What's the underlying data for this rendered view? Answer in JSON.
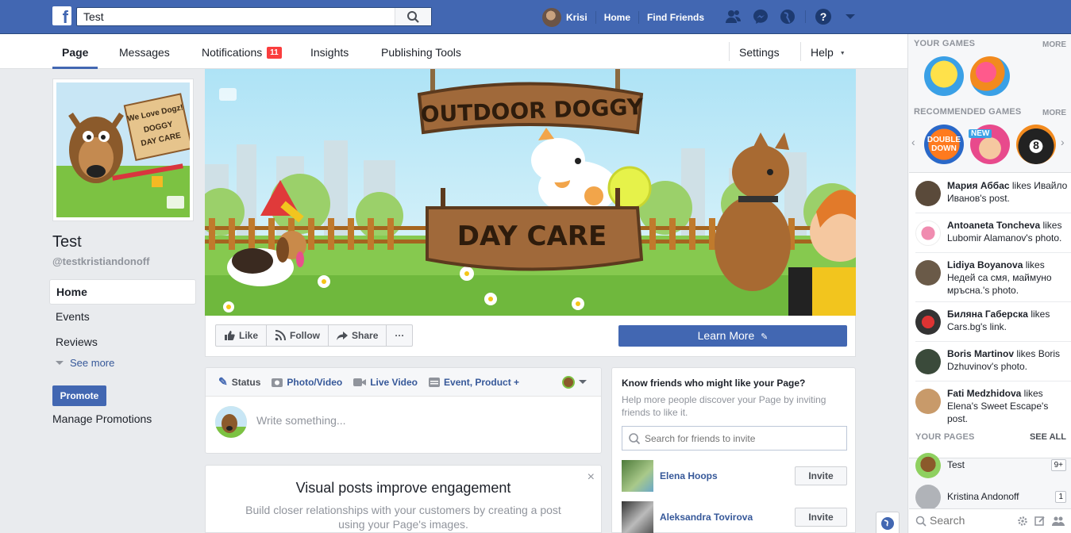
{
  "topbar": {
    "logo_letter": "f",
    "search_value": "Test",
    "user_name": "Krisi",
    "home": "Home",
    "find_friends": "Find Friends"
  },
  "pagenav": {
    "tabs": [
      {
        "label": "Page"
      },
      {
        "label": "Messages"
      },
      {
        "label": "Notifications",
        "badge": "11"
      },
      {
        "label": "Insights"
      },
      {
        "label": "Publishing Tools"
      }
    ],
    "settings": "Settings",
    "help": "Help",
    "help_caret": "▼"
  },
  "profile": {
    "name": "Test",
    "handle": "@testkristiandonoff",
    "pic_sign": [
      "We Love Dogz!",
      "DOGGY",
      "DAY CARE"
    ]
  },
  "leftnav": {
    "items": [
      "Home",
      "Events",
      "Reviews"
    ],
    "see_more": "See more",
    "promote": "Promote",
    "manage_promotions": "Manage Promotions"
  },
  "cover": {
    "sign_top": "OUTDOOR DOGGY",
    "sign_bottom": "DAY CARE"
  },
  "actions": {
    "like": "Like",
    "follow": "Follow",
    "share": "Share",
    "more": "···",
    "learn_more": "Learn More"
  },
  "composer": {
    "tabs": [
      "Status",
      "Photo/Video",
      "Live Video",
      "Event, Product +"
    ],
    "placeholder": "Write something..."
  },
  "visual_card": {
    "title": "Visual posts improve engagement",
    "desc": "Build closer relationships with your customers by creating a post using your Page's images.",
    "close": "×"
  },
  "invite": {
    "title": "Know friends who might like your Page?",
    "desc": "Help more people discover your Page by inviting friends to like it.",
    "search_placeholder": "Search for friends to invite",
    "friends": [
      {
        "name": "Elena Hoops",
        "button": "Invite"
      },
      {
        "name": "Aleksandra Tovirova",
        "button": "Invite"
      }
    ]
  },
  "sidebar": {
    "your_games": "YOUR GAMES",
    "more": "MORE",
    "recommended_games": "RECOMMENDED GAMES",
    "game_labels": {
      "double_down": "DOUBLE DOWN",
      "new": "NEW",
      "eight_ball": "8"
    },
    "ticker": [
      {
        "actor": "Мария Аббас",
        "text": " likes Ивайло Иванов's post."
      },
      {
        "actor": "Antoaneta Toncheva",
        "text": " likes Lubomir Alamanov's photo."
      },
      {
        "actor": "Lidiya Boyanova",
        "text": " likes Недей са смя, маймуно мръсна.'s photo."
      },
      {
        "actor": "Биляна Габерска",
        "text": " likes Cars.bg's link."
      },
      {
        "actor": "Boris Martinov",
        "text": " likes Boris Dzhuvinov's photo."
      },
      {
        "actor": "Fati Medzhidova",
        "text": " likes Elena's Sweet Escape's post."
      }
    ],
    "your_pages": "YOUR PAGES",
    "see_all": "SEE ALL",
    "pages": [
      {
        "name": "Test",
        "count": "9+"
      },
      {
        "name": "Kristina Andonoff",
        "count": "1"
      }
    ],
    "search_placeholder": "Search"
  },
  "colors": {
    "brand_blue": "#4267b2",
    "link_blue": "#365899",
    "badge_red": "#fa3e3e"
  }
}
